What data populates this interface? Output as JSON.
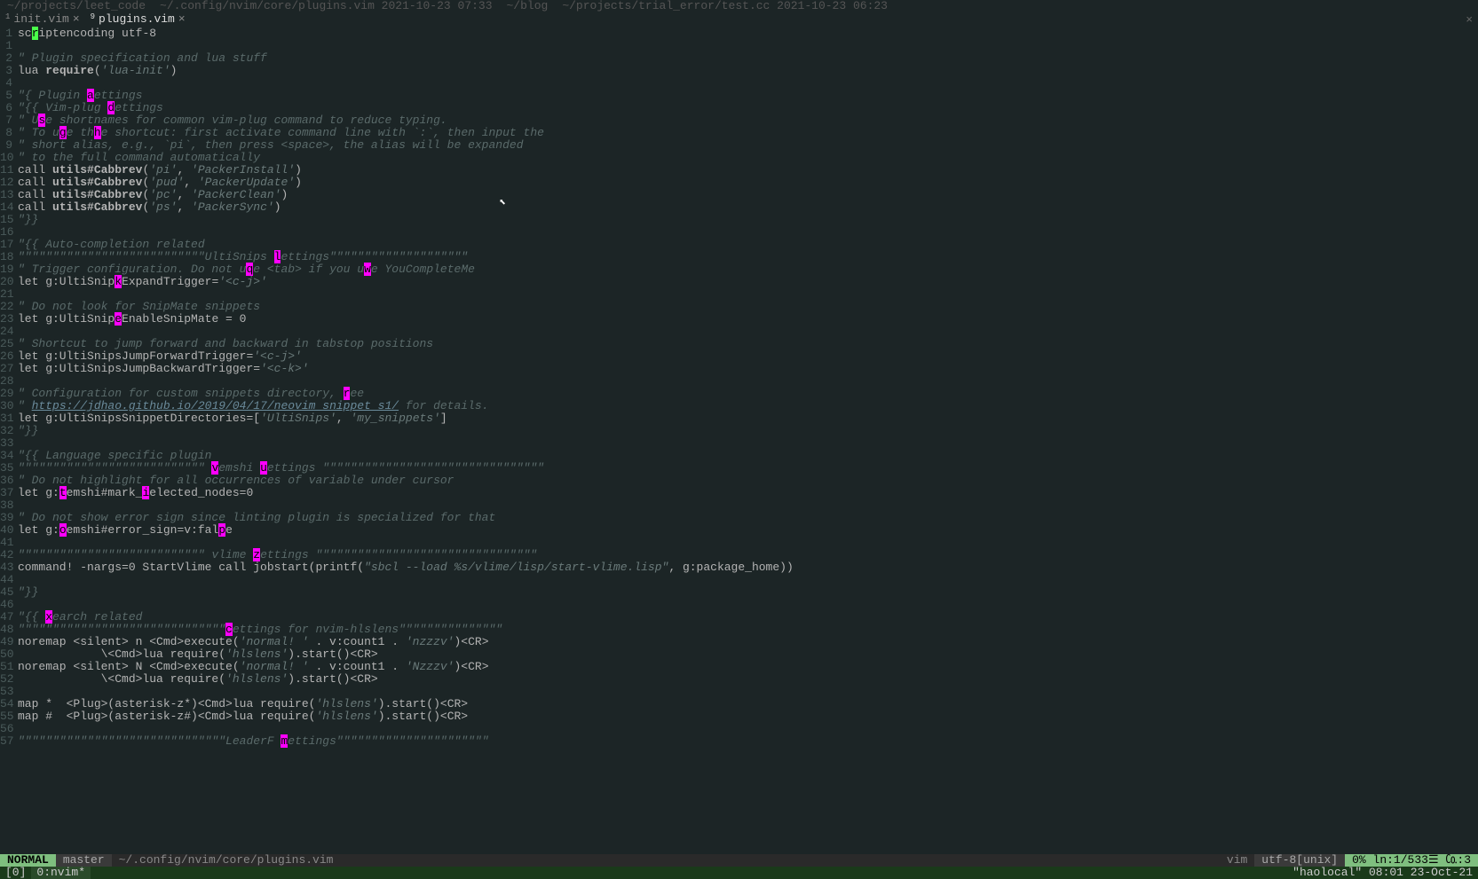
{
  "tmux_top": {
    "pane1": "~/projects/leet_code",
    "pane2": "~/.config/nvim/core/plugins.vim 2021-10-23 07:33",
    "pane3": "~/blog",
    "pane4": "~/projects/trial_error/test.cc 2021-10-23 06:23"
  },
  "tabs": [
    {
      "num": "1",
      "name": "init.vim",
      "close": "×"
    },
    {
      "num": "9",
      "name": "plugins.vim",
      "close": "×"
    }
  ],
  "close_icon": "×",
  "lines": [
    {
      "n": "1",
      "segs": [
        {
          "t": "sc",
          "c": "keyword"
        },
        {
          "t": "r",
          "c": "cursor"
        },
        {
          "t": "iptencoding utf-8",
          "c": "keyword"
        }
      ]
    },
    {
      "n": "1",
      "segs": []
    },
    {
      "n": "2",
      "segs": [
        {
          "t": "\" Plugin specification and lua stuff",
          "c": "comment"
        }
      ]
    },
    {
      "n": "3",
      "segs": [
        {
          "t": "lua ",
          "c": "keyword"
        },
        {
          "t": "require",
          "c": "func"
        },
        {
          "t": "(",
          "c": "keyword"
        },
        {
          "t": "'lua-init'",
          "c": "string"
        },
        {
          "t": ")",
          "c": "keyword"
        }
      ]
    },
    {
      "n": "4",
      "segs": []
    },
    {
      "n": "5",
      "segs": [
        {
          "t": "\"{ Plugin ",
          "c": "comment"
        },
        {
          "t": "a",
          "c": "hop"
        },
        {
          "t": "ettings",
          "c": "comment"
        }
      ]
    },
    {
      "n": "6",
      "segs": [
        {
          "t": "\"{{ Vim-plug ",
          "c": "comment"
        },
        {
          "t": "d",
          "c": "hop"
        },
        {
          "t": "ettings",
          "c": "comment"
        }
      ]
    },
    {
      "n": "7",
      "segs": [
        {
          "t": "\" U",
          "c": "comment"
        },
        {
          "t": "s",
          "c": "hop"
        },
        {
          "t": "e shortnames for common vim-plug command to reduce typing.",
          "c": "comment"
        }
      ]
    },
    {
      "n": "8",
      "segs": [
        {
          "t": "\" To u",
          "c": "comment"
        },
        {
          "t": "g",
          "c": "hop"
        },
        {
          "t": "e th",
          "c": "comment"
        },
        {
          "t": "h",
          "c": "hop"
        },
        {
          "t": "e shortcut: first activate command line with `:`, then input the",
          "c": "comment"
        }
      ]
    },
    {
      "n": "9",
      "segs": [
        {
          "t": "\" short alias, e.g., `pi`, then press <space>, the alias will be expanded",
          "c": "comment"
        }
      ]
    },
    {
      "n": "10",
      "segs": [
        {
          "t": "\" to the full command automatically",
          "c": "comment"
        }
      ]
    },
    {
      "n": "11",
      "segs": [
        {
          "t": "call ",
          "c": "keyword"
        },
        {
          "t": "utils#Cabbrev",
          "c": "func"
        },
        {
          "t": "(",
          "c": "keyword"
        },
        {
          "t": "'pi'",
          "c": "string"
        },
        {
          "t": ", ",
          "c": "keyword"
        },
        {
          "t": "'PackerInstall'",
          "c": "string"
        },
        {
          "t": ")",
          "c": "keyword"
        }
      ]
    },
    {
      "n": "12",
      "segs": [
        {
          "t": "call ",
          "c": "keyword"
        },
        {
          "t": "utils#Cabbrev",
          "c": "func"
        },
        {
          "t": "(",
          "c": "keyword"
        },
        {
          "t": "'pud'",
          "c": "string"
        },
        {
          "t": ", ",
          "c": "keyword"
        },
        {
          "t": "'PackerUpdate'",
          "c": "string"
        },
        {
          "t": ")",
          "c": "keyword"
        }
      ]
    },
    {
      "n": "13",
      "segs": [
        {
          "t": "call ",
          "c": "keyword"
        },
        {
          "t": "utils#Cabbrev",
          "c": "func"
        },
        {
          "t": "(",
          "c": "keyword"
        },
        {
          "t": "'pc'",
          "c": "string"
        },
        {
          "t": ", ",
          "c": "keyword"
        },
        {
          "t": "'PackerClean'",
          "c": "string"
        },
        {
          "t": ")",
          "c": "keyword"
        }
      ]
    },
    {
      "n": "14",
      "segs": [
        {
          "t": "call ",
          "c": "keyword"
        },
        {
          "t": "utils#Cabbrev",
          "c": "func"
        },
        {
          "t": "(",
          "c": "keyword"
        },
        {
          "t": "'ps'",
          "c": "string"
        },
        {
          "t": ", ",
          "c": "keyword"
        },
        {
          "t": "'PackerSync'",
          "c": "string"
        },
        {
          "t": ")",
          "c": "keyword"
        }
      ]
    },
    {
      "n": "15",
      "segs": [
        {
          "t": "\"}}",
          "c": "comment"
        }
      ]
    },
    {
      "n": "16",
      "segs": []
    },
    {
      "n": "17",
      "segs": [
        {
          "t": "\"{{ Auto-completion related",
          "c": "comment"
        }
      ]
    },
    {
      "n": "18",
      "segs": [
        {
          "t": "\"\"\"\"\"\"\"\"\"\"\"\"\"\"\"\"\"\"\"\"\"\"\"\"\"\"\"UltiSnips ",
          "c": "comment"
        },
        {
          "t": "l",
          "c": "hop"
        },
        {
          "t": "ettings\"\"\"\"\"\"\"\"\"\"\"\"\"\"\"\"\"\"\"\"",
          "c": "comment"
        }
      ]
    },
    {
      "n": "19",
      "segs": [
        {
          "t": "\" Trigger configuration. Do not u",
          "c": "comment"
        },
        {
          "t": "q",
          "c": "hop"
        },
        {
          "t": "e <tab> if you u",
          "c": "comment"
        },
        {
          "t": "w",
          "c": "hop"
        },
        {
          "t": "e YouCompleteMe",
          "c": "comment"
        }
      ]
    },
    {
      "n": "20",
      "segs": [
        {
          "t": "let g:UltiSnip",
          "c": "keyword"
        },
        {
          "t": "k",
          "c": "hop"
        },
        {
          "t": "ExpandTrigger=",
          "c": "keyword"
        },
        {
          "t": "'<c-j>'",
          "c": "string"
        }
      ]
    },
    {
      "n": "21",
      "segs": []
    },
    {
      "n": "22",
      "segs": [
        {
          "t": "\" Do not look for SnipMate snippets",
          "c": "comment"
        }
      ]
    },
    {
      "n": "23",
      "segs": [
        {
          "t": "let g:UltiSnip",
          "c": "keyword"
        },
        {
          "t": "e",
          "c": "hop"
        },
        {
          "t": "EnableSnipMate = 0",
          "c": "keyword"
        }
      ]
    },
    {
      "n": "24",
      "segs": []
    },
    {
      "n": "25",
      "segs": [
        {
          "t": "\" Shortcut to jump forward and backward in tabstop positions",
          "c": "comment"
        }
      ]
    },
    {
      "n": "26",
      "segs": [
        {
          "t": "let g:UltiSnipsJumpForwardTrigger=",
          "c": "keyword"
        },
        {
          "t": "'<c-j>'",
          "c": "string"
        }
      ]
    },
    {
      "n": "27",
      "segs": [
        {
          "t": "let g:UltiSnipsJumpBackwardTrigger=",
          "c": "keyword"
        },
        {
          "t": "'<c-k>'",
          "c": "string"
        }
      ]
    },
    {
      "n": "28",
      "segs": []
    },
    {
      "n": "29",
      "segs": [
        {
          "t": "\" Configuration for custom snippets directory, ",
          "c": "comment"
        },
        {
          "t": "r",
          "c": "hop"
        },
        {
          "t": "ee",
          "c": "comment"
        }
      ]
    },
    {
      "n": "30",
      "segs": [
        {
          "t": "\" ",
          "c": "comment"
        },
        {
          "t": "https://jdhao.github.io/2019/04/17/neovim_snippet_s1/",
          "c": "url"
        },
        {
          "t": " for details.",
          "c": "comment"
        }
      ]
    },
    {
      "n": "31",
      "segs": [
        {
          "t": "let g:UltiSnipsSnippetDirectories=[",
          "c": "keyword"
        },
        {
          "t": "'UltiSnips'",
          "c": "string"
        },
        {
          "t": ", ",
          "c": "keyword"
        },
        {
          "t": "'my_snippets'",
          "c": "string"
        },
        {
          "t": "]",
          "c": "keyword"
        }
      ]
    },
    {
      "n": "32",
      "segs": [
        {
          "t": "\"}}",
          "c": "comment"
        }
      ]
    },
    {
      "n": "33",
      "segs": []
    },
    {
      "n": "34",
      "segs": [
        {
          "t": "\"{{ Language specific plugin",
          "c": "comment"
        }
      ]
    },
    {
      "n": "35",
      "segs": [
        {
          "t": "\"\"\"\"\"\"\"\"\"\"\"\"\"\"\"\"\"\"\"\"\"\"\"\"\"\"\" ",
          "c": "comment"
        },
        {
          "t": "v",
          "c": "hop"
        },
        {
          "t": "emshi ",
          "c": "comment"
        },
        {
          "t": "u",
          "c": "hop"
        },
        {
          "t": "ettings \"\"\"\"\"\"\"\"\"\"\"\"\"\"\"\"\"\"\"\"\"\"\"\"\"\"\"\"\"\"\"\"",
          "c": "comment"
        }
      ]
    },
    {
      "n": "36",
      "segs": [
        {
          "t": "\" Do not highlight for all occurrences of variable under cursor",
          "c": "comment"
        }
      ]
    },
    {
      "n": "37",
      "segs": [
        {
          "t": "let g:",
          "c": "keyword"
        },
        {
          "t": "t",
          "c": "hop"
        },
        {
          "t": "emshi#mark_",
          "c": "keyword"
        },
        {
          "t": "i",
          "c": "hop"
        },
        {
          "t": "elected_nodes=0",
          "c": "keyword"
        }
      ]
    },
    {
      "n": "38",
      "segs": []
    },
    {
      "n": "39",
      "segs": [
        {
          "t": "\" Do not show error sign since linting plugin is specialized for that",
          "c": "comment"
        }
      ]
    },
    {
      "n": "40",
      "segs": [
        {
          "t": "let g:",
          "c": "keyword"
        },
        {
          "t": "o",
          "c": "hop"
        },
        {
          "t": "emshi#error_sign=v:fal",
          "c": "keyword"
        },
        {
          "t": "p",
          "c": "hop"
        },
        {
          "t": "e",
          "c": "keyword"
        }
      ]
    },
    {
      "n": "41",
      "segs": []
    },
    {
      "n": "42",
      "segs": [
        {
          "t": "\"\"\"\"\"\"\"\"\"\"\"\"\"\"\"\"\"\"\"\"\"\"\"\"\"\"\" vlime ",
          "c": "comment"
        },
        {
          "t": "z",
          "c": "hop"
        },
        {
          "t": "ettings \"\"\"\"\"\"\"\"\"\"\"\"\"\"\"\"\"\"\"\"\"\"\"\"\"\"\"\"\"\"\"\"",
          "c": "comment"
        }
      ]
    },
    {
      "n": "43",
      "segs": [
        {
          "t": "command! -nargs=0 StartVlime call jobstart(printf(",
          "c": "keyword"
        },
        {
          "t": "\"sbcl --load %s/vlime/lisp/start-vlime.lisp\"",
          "c": "string"
        },
        {
          "t": ", g:package_home))",
          "c": "keyword"
        }
      ]
    },
    {
      "n": "44",
      "segs": []
    },
    {
      "n": "45",
      "segs": [
        {
          "t": "\"}}",
          "c": "comment"
        }
      ]
    },
    {
      "n": "46",
      "segs": []
    },
    {
      "n": "47",
      "segs": [
        {
          "t": "\"{{ ",
          "c": "comment"
        },
        {
          "t": "x",
          "c": "hop"
        },
        {
          "t": "earch related",
          "c": "comment"
        }
      ]
    },
    {
      "n": "48",
      "segs": [
        {
          "t": "\"\"\"\"\"\"\"\"\"\"\"\"\"\"\"\"\"\"\"\"\"\"\"\"\"\"\"\"\"\"",
          "c": "comment"
        },
        {
          "t": "c",
          "c": "hop"
        },
        {
          "t": "ettings for nvim-hlslens\"\"\"\"\"\"\"\"\"\"\"\"\"\"\"",
          "c": "comment"
        }
      ]
    },
    {
      "n": "49",
      "segs": [
        {
          "t": "noremap <silent> n <Cmd>execute(",
          "c": "keyword"
        },
        {
          "t": "'normal! '",
          "c": "string"
        },
        {
          "t": " . v:count1 . ",
          "c": "keyword"
        },
        {
          "t": "'nzzzv'",
          "c": "string"
        },
        {
          "t": ")<CR>",
          "c": "keyword"
        }
      ]
    },
    {
      "n": "50",
      "segs": [
        {
          "t": "            \\<Cmd>lua require(",
          "c": "keyword"
        },
        {
          "t": "'hlslens'",
          "c": "string"
        },
        {
          "t": ").start()<CR>",
          "c": "keyword"
        }
      ]
    },
    {
      "n": "51",
      "segs": [
        {
          "t": "noremap <silent> N <Cmd>execute(",
          "c": "keyword"
        },
        {
          "t": "'normal! '",
          "c": "string"
        },
        {
          "t": " . v:count1 . ",
          "c": "keyword"
        },
        {
          "t": "'Nzzzv'",
          "c": "string"
        },
        {
          "t": ")<CR>",
          "c": "keyword"
        }
      ]
    },
    {
      "n": "52",
      "segs": [
        {
          "t": "            \\<Cmd>lua require(",
          "c": "keyword"
        },
        {
          "t": "'hlslens'",
          "c": "string"
        },
        {
          "t": ").start()<CR>",
          "c": "keyword"
        }
      ]
    },
    {
      "n": "53",
      "segs": []
    },
    {
      "n": "54",
      "segs": [
        {
          "t": "map *  <Plug>(asterisk-z*)<Cmd>lua require(",
          "c": "keyword"
        },
        {
          "t": "'hlslens'",
          "c": "string"
        },
        {
          "t": ").start()<CR>",
          "c": "keyword"
        }
      ]
    },
    {
      "n": "55",
      "segs": [
        {
          "t": "map #  <Plug>(asterisk-z#)<Cmd>lua require(",
          "c": "keyword"
        },
        {
          "t": "'hlslens'",
          "c": "string"
        },
        {
          "t": ").start()<CR>",
          "c": "keyword"
        }
      ]
    },
    {
      "n": "56",
      "segs": []
    },
    {
      "n": "57",
      "segs": [
        {
          "t": "\"\"\"\"\"\"\"\"\"\"\"\"\"\"\"\"\"\"\"\"\"\"\"\"\"\"\"\"\"\"LeaderF ",
          "c": "comment"
        },
        {
          "t": "m",
          "c": "hop"
        },
        {
          "t": "ettings\"\"\"\"\"\"\"\"\"\"\"\"\"\"\"\"\"\"\"\"\"\"",
          "c": "comment"
        }
      ]
    }
  ],
  "status": {
    "mode": "NORMAL",
    "branch": " master",
    "file": "~/.config/nvim/core/plugins.vim",
    "filetype": "vim",
    "encoding": "utf-8[unix]",
    "position": " 0% ln:1/533☰ ㏇:3"
  },
  "tmux_bottom": {
    "session": "[0]",
    "window": "0:nvim*",
    "right": "\"haolocal\" 08:01 23-Oct-21"
  }
}
